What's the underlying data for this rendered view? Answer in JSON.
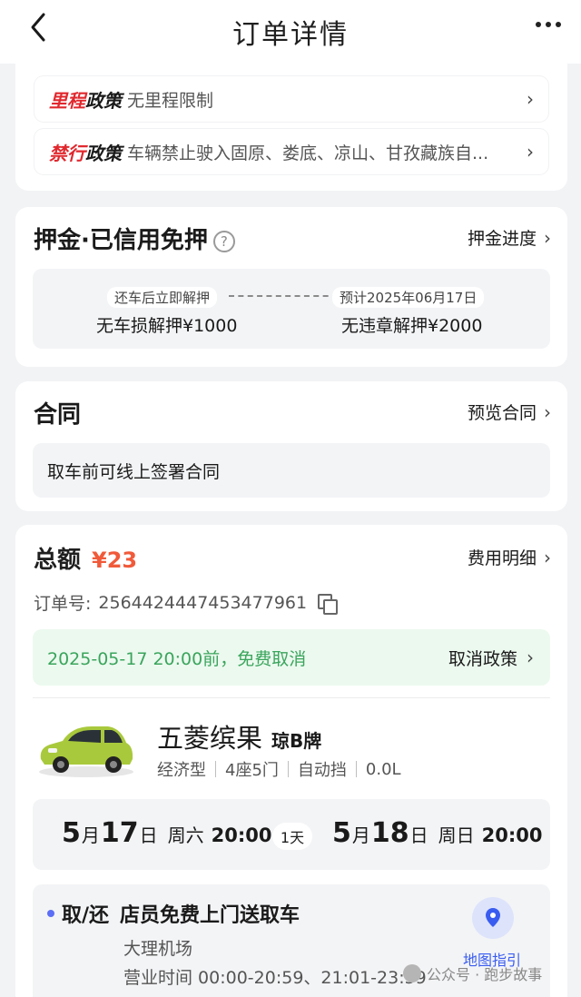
{
  "header": {
    "title": "订单详情"
  },
  "policies": [
    {
      "tag_red": "里程",
      "tag_black": "政策",
      "text": "无里程限制"
    },
    {
      "tag_red": "禁行",
      "tag_black": "政策",
      "text": "车辆禁止驶入固原、娄底、凉山、甘孜藏族自..."
    }
  ],
  "deposit": {
    "title": "押金·已信用免押",
    "help": "?",
    "link": "押金进度",
    "step1": "还车后立即解押",
    "step2": "预计2025年06月17日",
    "value1": "无车损解押¥1000",
    "value2": "无违章解押¥2000"
  },
  "contract": {
    "title": "合同",
    "link": "预览合同",
    "note": "取车前可线上签署合同"
  },
  "order": {
    "total_label": "总额",
    "total_amount": "¥23",
    "fee_link": "费用明细",
    "order_no_label": "订单号:",
    "order_no": "2564424447453477961",
    "cancel_text": "2025-05-17 20:00前，免费取消",
    "cancel_link": "取消政策"
  },
  "car": {
    "name": "五菱缤果",
    "plate": "琼B牌",
    "specs": [
      "经济型",
      "4座5门",
      "自动挡",
      "0.0L"
    ]
  },
  "rental": {
    "start_month": "5",
    "start_day": "17",
    "start_week": "周六",
    "start_time": "20:00",
    "duration": "1天",
    "end_month": "5",
    "end_day": "18",
    "end_week": "周日",
    "end_time": "20:00",
    "month_unit": "月",
    "day_unit": "日"
  },
  "pickup": {
    "mode": "取/还",
    "service": "店员免费上门送取车",
    "location": "大理机场",
    "hours": "营业时间 00:00-20:59、21:01-23:59",
    "map_label": "地图指引"
  },
  "watermark": {
    "text": "公众号 · 跑步故事"
  },
  "colors": {
    "accent_red": "#e0282e",
    "amount": "#f05a3a",
    "green": "#3aa55c",
    "blue": "#3a5df0"
  }
}
